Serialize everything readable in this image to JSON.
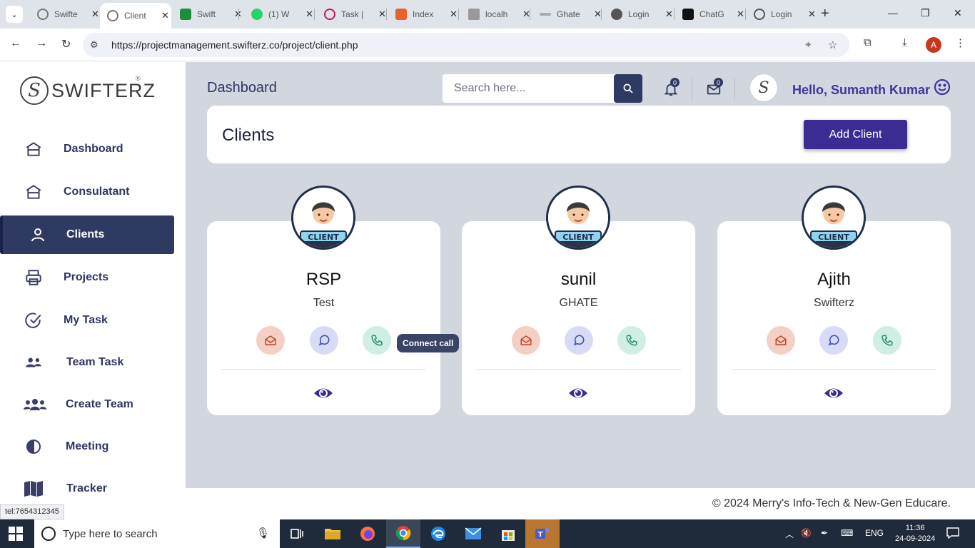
{
  "browser": {
    "tabs": [
      {
        "label": "Swifte",
        "color": "#dfe3ea"
      },
      {
        "label": "Client",
        "color": "#ffffff"
      },
      {
        "label": "Swift",
        "color": "#dfe3ea"
      },
      {
        "label": "(1) W",
        "color": "#dfe3ea"
      },
      {
        "label": "Task |",
        "color": "#dfe3ea"
      },
      {
        "label": "Index",
        "color": "#dfe3ea"
      },
      {
        "label": "localh",
        "color": "#dfe3ea"
      },
      {
        "label": "Ghate",
        "color": "#dfe3ea"
      },
      {
        "label": "Login",
        "color": "#dfe3ea"
      },
      {
        "label": "ChatG",
        "color": "#dfe3ea"
      },
      {
        "label": "Login",
        "color": "#dfe3ea"
      }
    ],
    "url": "https://projectmanagement.swifterz.co/project/client.php",
    "profile_initial": "A"
  },
  "sidebar": {
    "brand": "SWIFTERZ",
    "brand_reg": "®",
    "items": [
      {
        "label": "Dashboard",
        "icon": "home-icon"
      },
      {
        "label": "Consulatant",
        "icon": "home-icon"
      },
      {
        "label": "Clients",
        "icon": "user-icon",
        "active": true
      },
      {
        "label": "Projects",
        "icon": "printer-icon"
      },
      {
        "label": "My Task",
        "icon": "check-circle-icon"
      },
      {
        "label": "Team Task",
        "icon": "team-icon"
      },
      {
        "label": "Create Team",
        "icon": "users-icon"
      },
      {
        "label": "Meeting",
        "icon": "clock-icon"
      },
      {
        "label": "Tracker",
        "icon": "map-icon"
      }
    ]
  },
  "status_link": "tel:7654312345",
  "header": {
    "title": "Dashboard",
    "search_placeholder": "Search here...",
    "notifications_count": "0",
    "messages_count": "0",
    "greeting": "Hello, Sumanth Kumar"
  },
  "clients_panel": {
    "title": "Clients",
    "add_button": "Add Client"
  },
  "clients": [
    {
      "name": "RSP",
      "company": "Test",
      "badge": "CLIENT"
    },
    {
      "name": "sunil",
      "company": "GHATE",
      "badge": "CLIENT"
    },
    {
      "name": "Ajith",
      "company": "Swifterz",
      "badge": "CLIENT"
    }
  ],
  "tooltip": "Connect call",
  "footer": "© 2024  Merry's Info-Tech & New-Gen Educare.",
  "taskbar": {
    "search_placeholder": "Type here to search",
    "lang": "ENG",
    "time": "11:36",
    "date": "24-09-2024"
  },
  "colors": {
    "accent": "#3b2c94",
    "sidebar_active": "#2e3a61",
    "main_bg": "#d2d6de"
  }
}
